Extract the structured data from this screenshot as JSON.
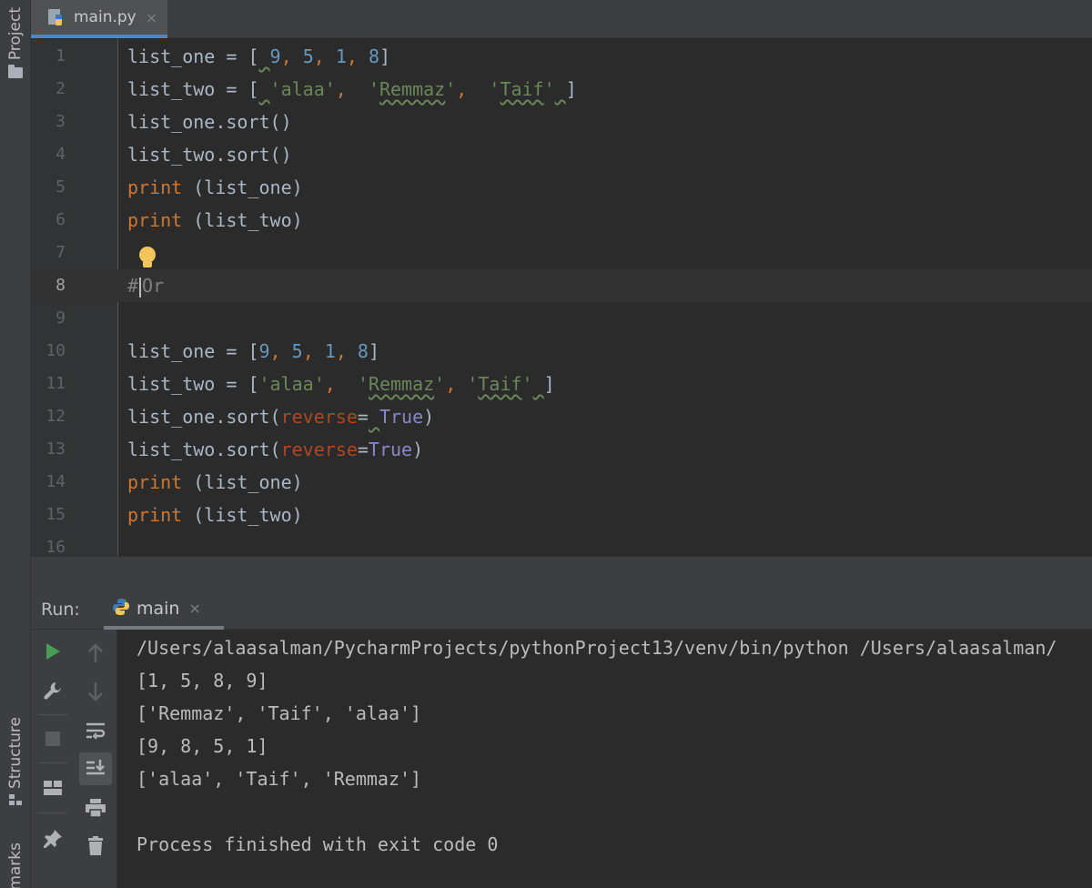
{
  "sidebar": {
    "project_label": "Project",
    "structure_label": "Structure",
    "bookmarks_label": "marks"
  },
  "editor_tab": {
    "filename": "main.py",
    "close": "×"
  },
  "editor": {
    "line_numbers": [
      "1",
      "2",
      "3",
      "4",
      "5",
      "6",
      "7",
      "8",
      "9",
      "10",
      "11",
      "12",
      "13",
      "14",
      "15",
      "16"
    ],
    "current_line": "8",
    "code": {
      "l1_name": "list_one = [",
      "l1_sp": " ",
      "l1_n1": "9",
      "l1_c1": ", ",
      "l1_n2": "5",
      "l1_c2": ", ",
      "l1_n3": "1",
      "l1_c3": ", ",
      "l1_n4": "8",
      "l1_end": "]",
      "l2_name": "list_two = [",
      "l2_sp": " ",
      "l2_s1": "'alaa'",
      "l2_c1": ",  ",
      "l2_s2q1": "'",
      "l2_s2": "Remmaz",
      "l2_s2q2": "'",
      "l2_c2": ",  ",
      "l2_s3q1": "'",
      "l2_s3": "Taif",
      "l2_s3q2": "'",
      "l2_sp2": " ",
      "l2_end": "]",
      "l3": "list_one.sort()",
      "l4": "list_two.sort()",
      "l5_kw": "print",
      "l5_rest": " (list_one)",
      "l6_kw": "print",
      "l6_rest": " (list_two)",
      "l8_hash": "#",
      "l8_rest": "Or",
      "l10_name": "list_one = [",
      "l10_n1": "9",
      "l10_c1": ", ",
      "l10_n2": "5",
      "l10_c2": ", ",
      "l10_n3": "1",
      "l10_c3": ", ",
      "l10_n4": "8",
      "l10_end": "]",
      "l11_name": "list_two = [",
      "l11_s1": "'alaa'",
      "l11_c1": ",  ",
      "l11_s2q1": "'",
      "l11_s2": "Remmaz",
      "l11_s2q2": "'",
      "l11_c2": ", ",
      "l11_s3q1": "'",
      "l11_s3": "Taif",
      "l11_s3q2": "'",
      "l11_sp": " ",
      "l11_end": "]",
      "l12_obj": "list_one.sort(",
      "l12_param": "reverse",
      "l12_eq": "=",
      "l12_sp": " ",
      "l12_val": "True",
      "l12_end": ")",
      "l13_obj": "list_two.sort(",
      "l13_param": "reverse",
      "l13_eq": "=",
      "l13_val": "True",
      "l13_end": ")",
      "l14_kw": "print",
      "l14_rest": " (list_one)",
      "l15_kw": "print",
      "l15_rest": " (list_two)"
    }
  },
  "run": {
    "title": "Run:",
    "tab_label": "main",
    "tab_close": "×",
    "toolbar_icons": [
      "run-icon",
      "wrench-icon",
      "stop-icon",
      "layout-icon",
      "pin-icon",
      "up-arrow-icon",
      "down-arrow-icon",
      "soft-wrap-icon",
      "scroll-to-end-icon",
      "print-icon",
      "trash-icon"
    ],
    "output": [
      "/Users/alaasalman/PycharmProjects/pythonProject13/venv/bin/python /Users/alaasalman/",
      "[1, 5, 8, 9]",
      "['Remmaz', 'Taif', 'alaa']",
      "[9, 8, 5, 1]",
      "['alaa', 'Taif', 'Remmaz']",
      "",
      "Process finished with exit code 0"
    ]
  },
  "colors": {
    "keyword": "#cc7832",
    "number": "#6897bb",
    "string": "#6a8759",
    "parameter": "#aa4926",
    "boolean": "#8888c6",
    "run_green": "#499c54"
  }
}
